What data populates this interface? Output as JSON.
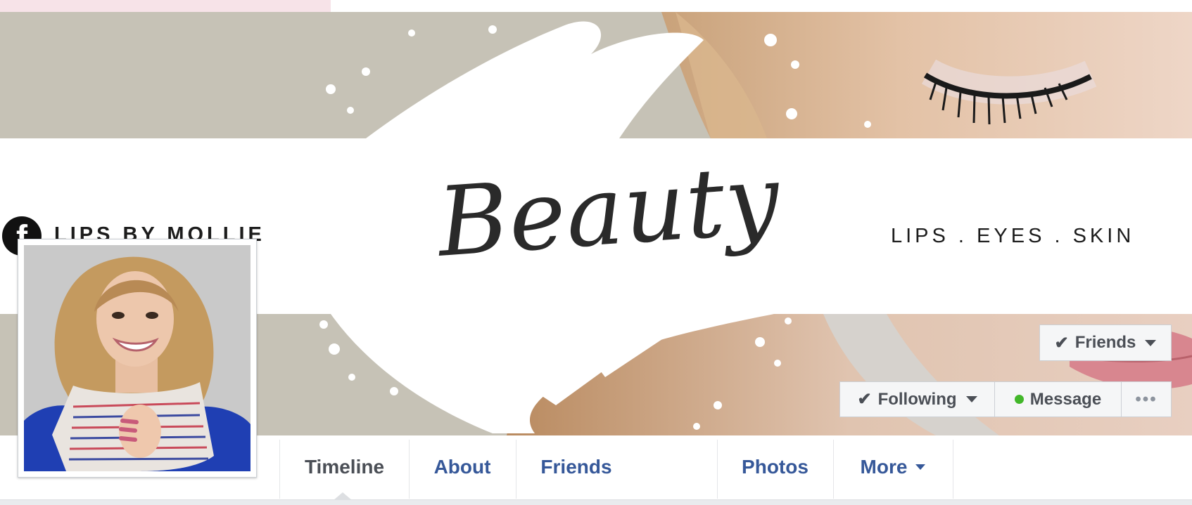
{
  "cover": {
    "brand_name": "LIPS BY MOLLIE",
    "fb_glyph": "f",
    "title": "Beauty",
    "tagline": "LIPS . EYES . SKIN"
  },
  "actions": {
    "friends_label": "Friends",
    "following_label": "Following",
    "message_label": "Message",
    "more_options_label": "•••",
    "check_glyph": "✔",
    "online_status_color": "#42b72a"
  },
  "nav": {
    "tabs": [
      {
        "label": "Timeline",
        "active": true
      },
      {
        "label": "About"
      },
      {
        "label": "Friends"
      },
      {
        "label": "Photos"
      },
      {
        "label": "More",
        "has_dropdown": true
      }
    ]
  },
  "colors": {
    "link": "#365899",
    "active_tab": "#4b4f56",
    "button_bg": "#f5f6f7"
  },
  "icons": {
    "facebook": "facebook-icon",
    "check": "check-icon",
    "caret": "chevron-down-icon",
    "online": "online-dot-icon",
    "more": "ellipsis-icon"
  }
}
